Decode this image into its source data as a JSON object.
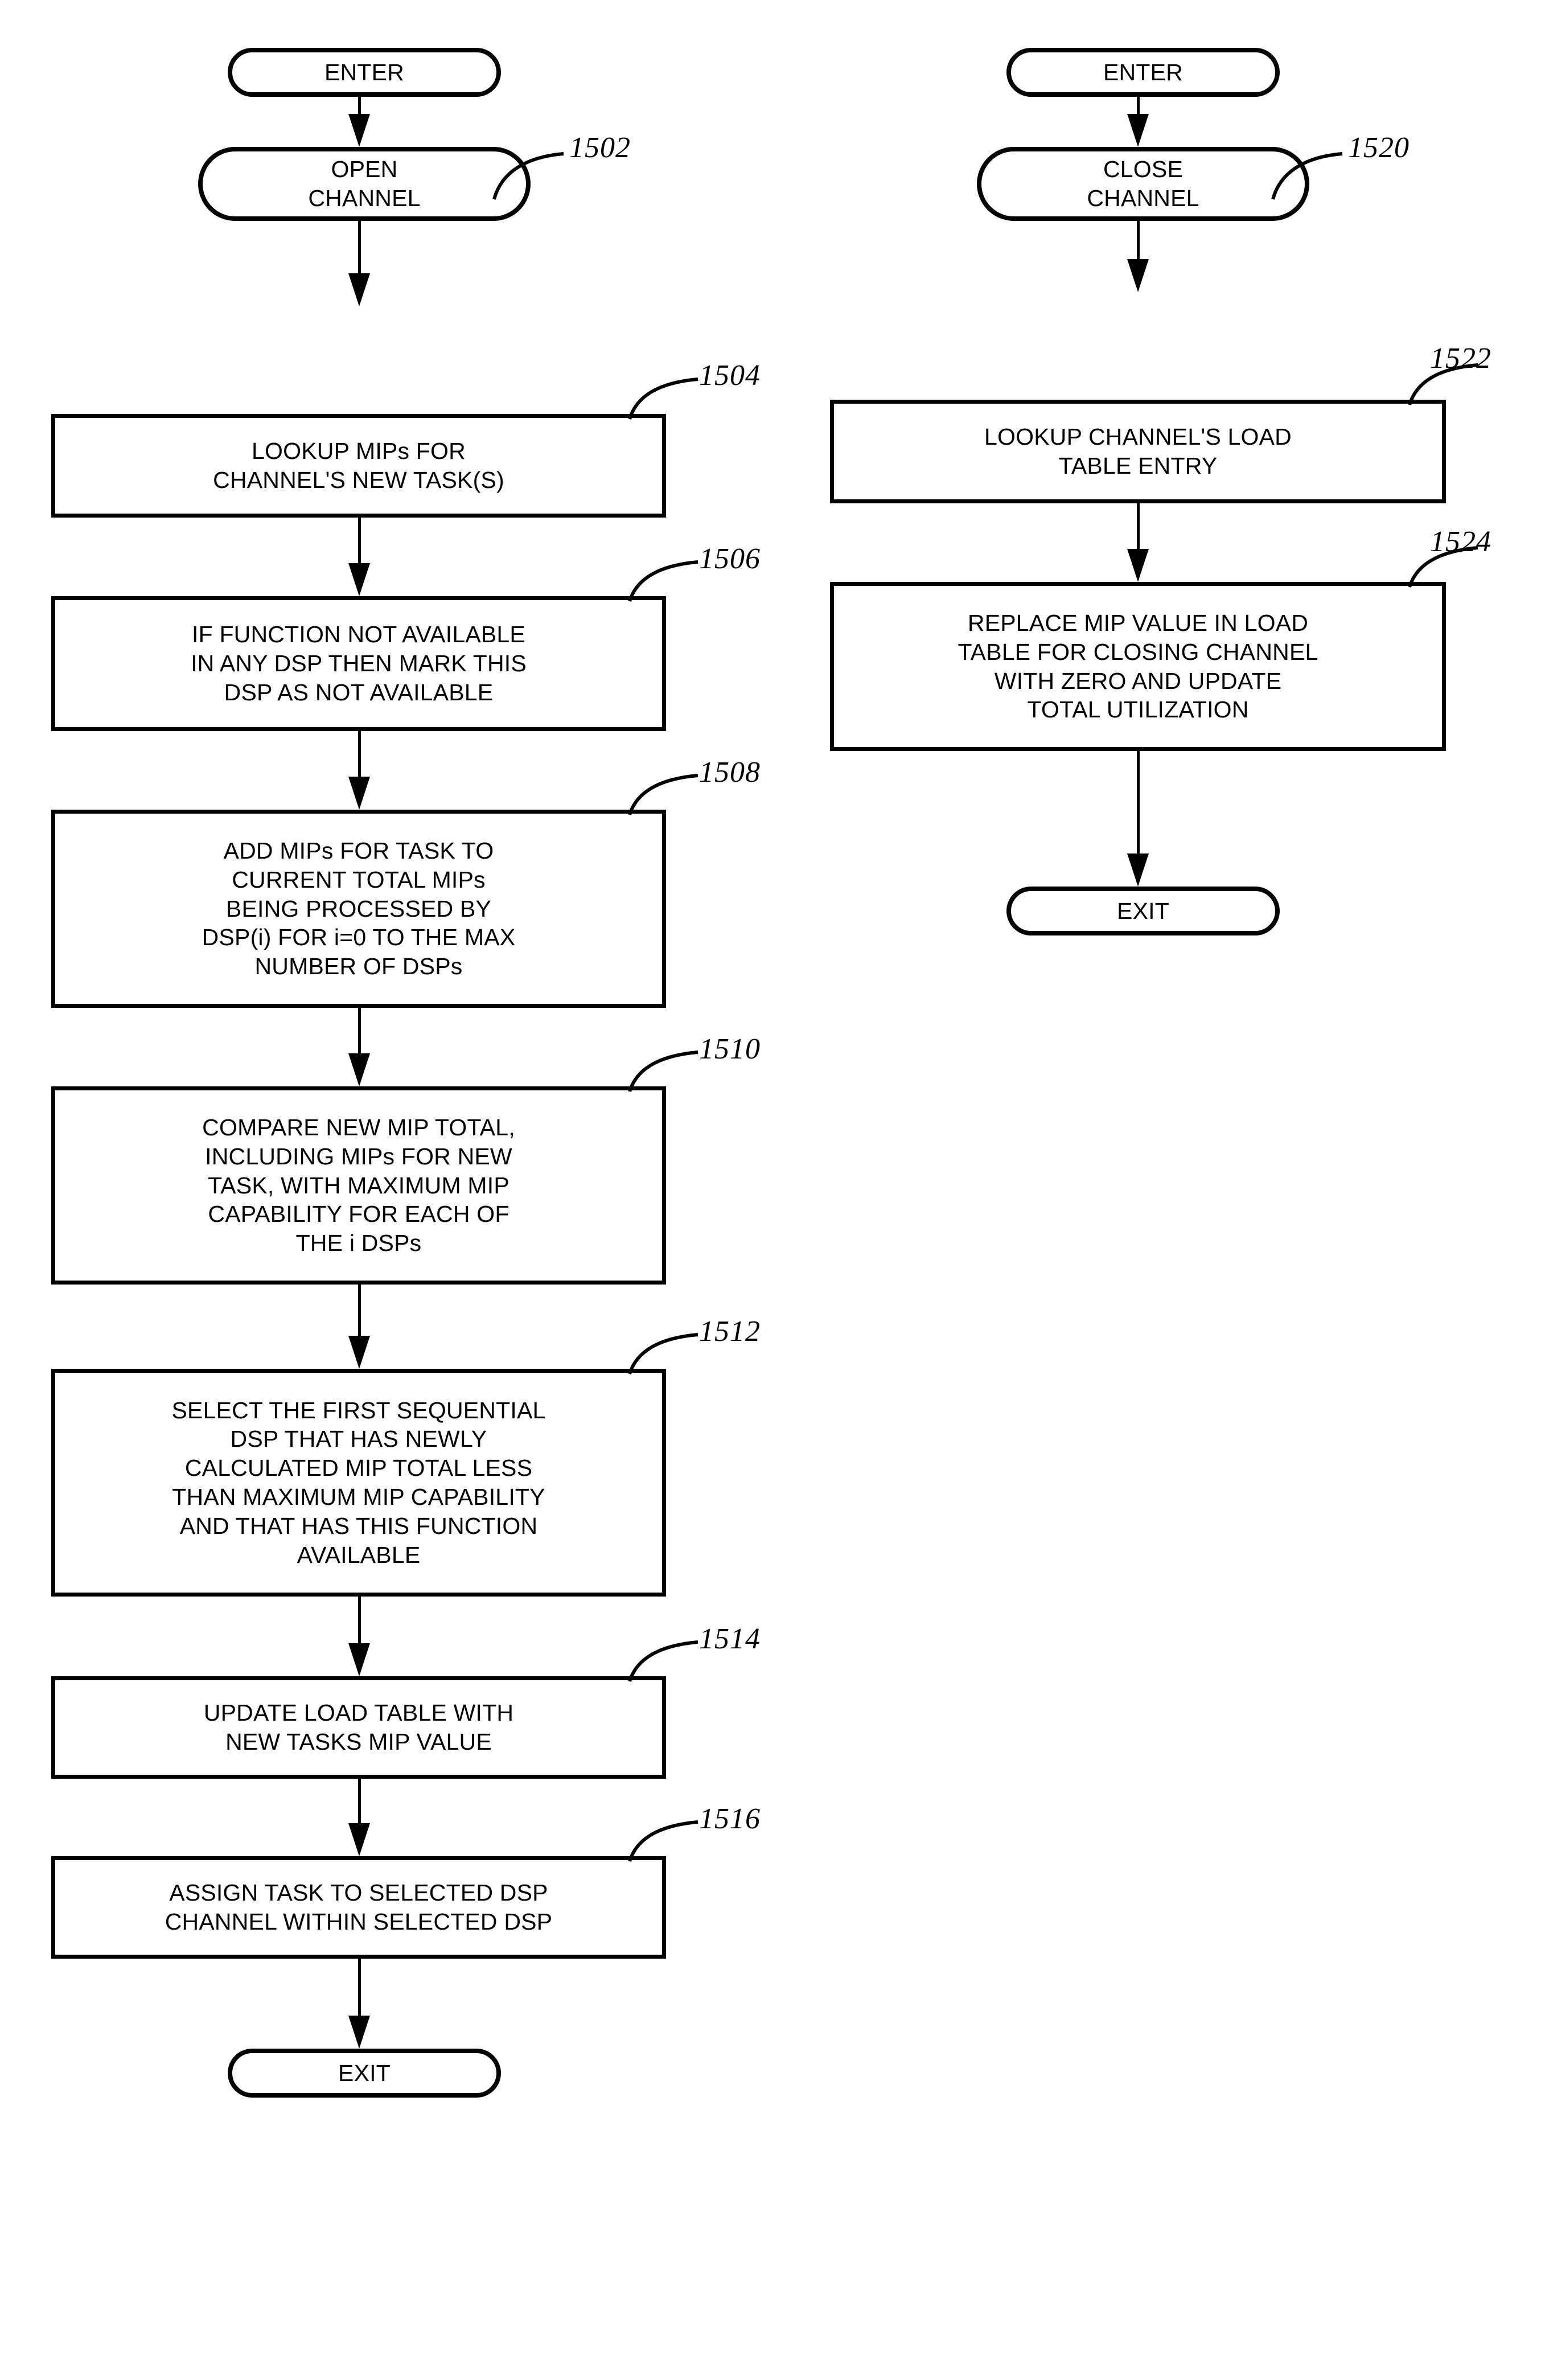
{
  "figure": {
    "kind": "patent-flowchart",
    "columns": [
      {
        "name": "open-channel-flow",
        "nodes": [
          {
            "id": "enter-left",
            "shape": "terminator",
            "label": "ENTER",
            "ref": null
          },
          {
            "id": "open-channel",
            "shape": "terminator",
            "label": "OPEN\nCHANNEL",
            "ref": "1502"
          },
          {
            "id": "step-1504",
            "shape": "process",
            "label": "LOOKUP MIPs FOR\nCHANNEL'S NEW TASK(S)",
            "ref": "1504"
          },
          {
            "id": "step-1506",
            "shape": "process",
            "label": "IF FUNCTION NOT AVAILABLE\nIN ANY DSP THEN MARK THIS\nDSP AS NOT AVAILABLE",
            "ref": "1506"
          },
          {
            "id": "step-1508",
            "shape": "process",
            "label": "ADD MIPs FOR TASK TO\nCURRENT TOTAL MIPs\nBEING PROCESSED BY\nDSP(i) FOR i=0 TO THE MAX\nNUMBER OF DSPs",
            "ref": "1508"
          },
          {
            "id": "step-1510",
            "shape": "process",
            "label": "COMPARE NEW MIP TOTAL,\nINCLUDING MIPs FOR NEW\nTASK, WITH MAXIMUM MIP\nCAPABILITY FOR EACH OF\nTHE i DSPs",
            "ref": "1510"
          },
          {
            "id": "step-1512",
            "shape": "process",
            "label": "SELECT THE FIRST SEQUENTIAL\nDSP THAT HAS NEWLY\nCALCULATED MIP TOTAL LESS\nTHAN MAXIMUM MIP CAPABILITY\nAND THAT HAS THIS FUNCTION\nAVAILABLE",
            "ref": "1512"
          },
          {
            "id": "step-1514",
            "shape": "process",
            "label": "UPDATE LOAD TABLE WITH\nNEW TASKS MIP VALUE",
            "ref": "1514"
          },
          {
            "id": "step-1516",
            "shape": "process",
            "label": "ASSIGN TASK TO SELECTED DSP\nCHANNEL WITHIN SELECTED DSP",
            "ref": "1516"
          },
          {
            "id": "exit-left",
            "shape": "terminator",
            "label": "EXIT",
            "ref": null
          }
        ]
      },
      {
        "name": "close-channel-flow",
        "nodes": [
          {
            "id": "enter-right",
            "shape": "terminator",
            "label": "ENTER",
            "ref": null
          },
          {
            "id": "close-channel",
            "shape": "terminator",
            "label": "CLOSE\nCHANNEL",
            "ref": "1520"
          },
          {
            "id": "step-1522",
            "shape": "process",
            "label": "LOOKUP CHANNEL'S LOAD\nTABLE ENTRY",
            "ref": "1522"
          },
          {
            "id": "step-1524",
            "shape": "process",
            "label": "REPLACE MIP VALUE IN LOAD\nTABLE FOR CLOSING CHANNEL\nWITH ZERO AND UPDATE\nTOTAL UTILIZATION",
            "ref": "1524"
          },
          {
            "id": "exit-right",
            "shape": "terminator",
            "label": "EXIT",
            "ref": null
          }
        ]
      }
    ],
    "colors": {
      "line": "#000000",
      "fill": "#ffffff",
      "text": "#000000"
    }
  }
}
